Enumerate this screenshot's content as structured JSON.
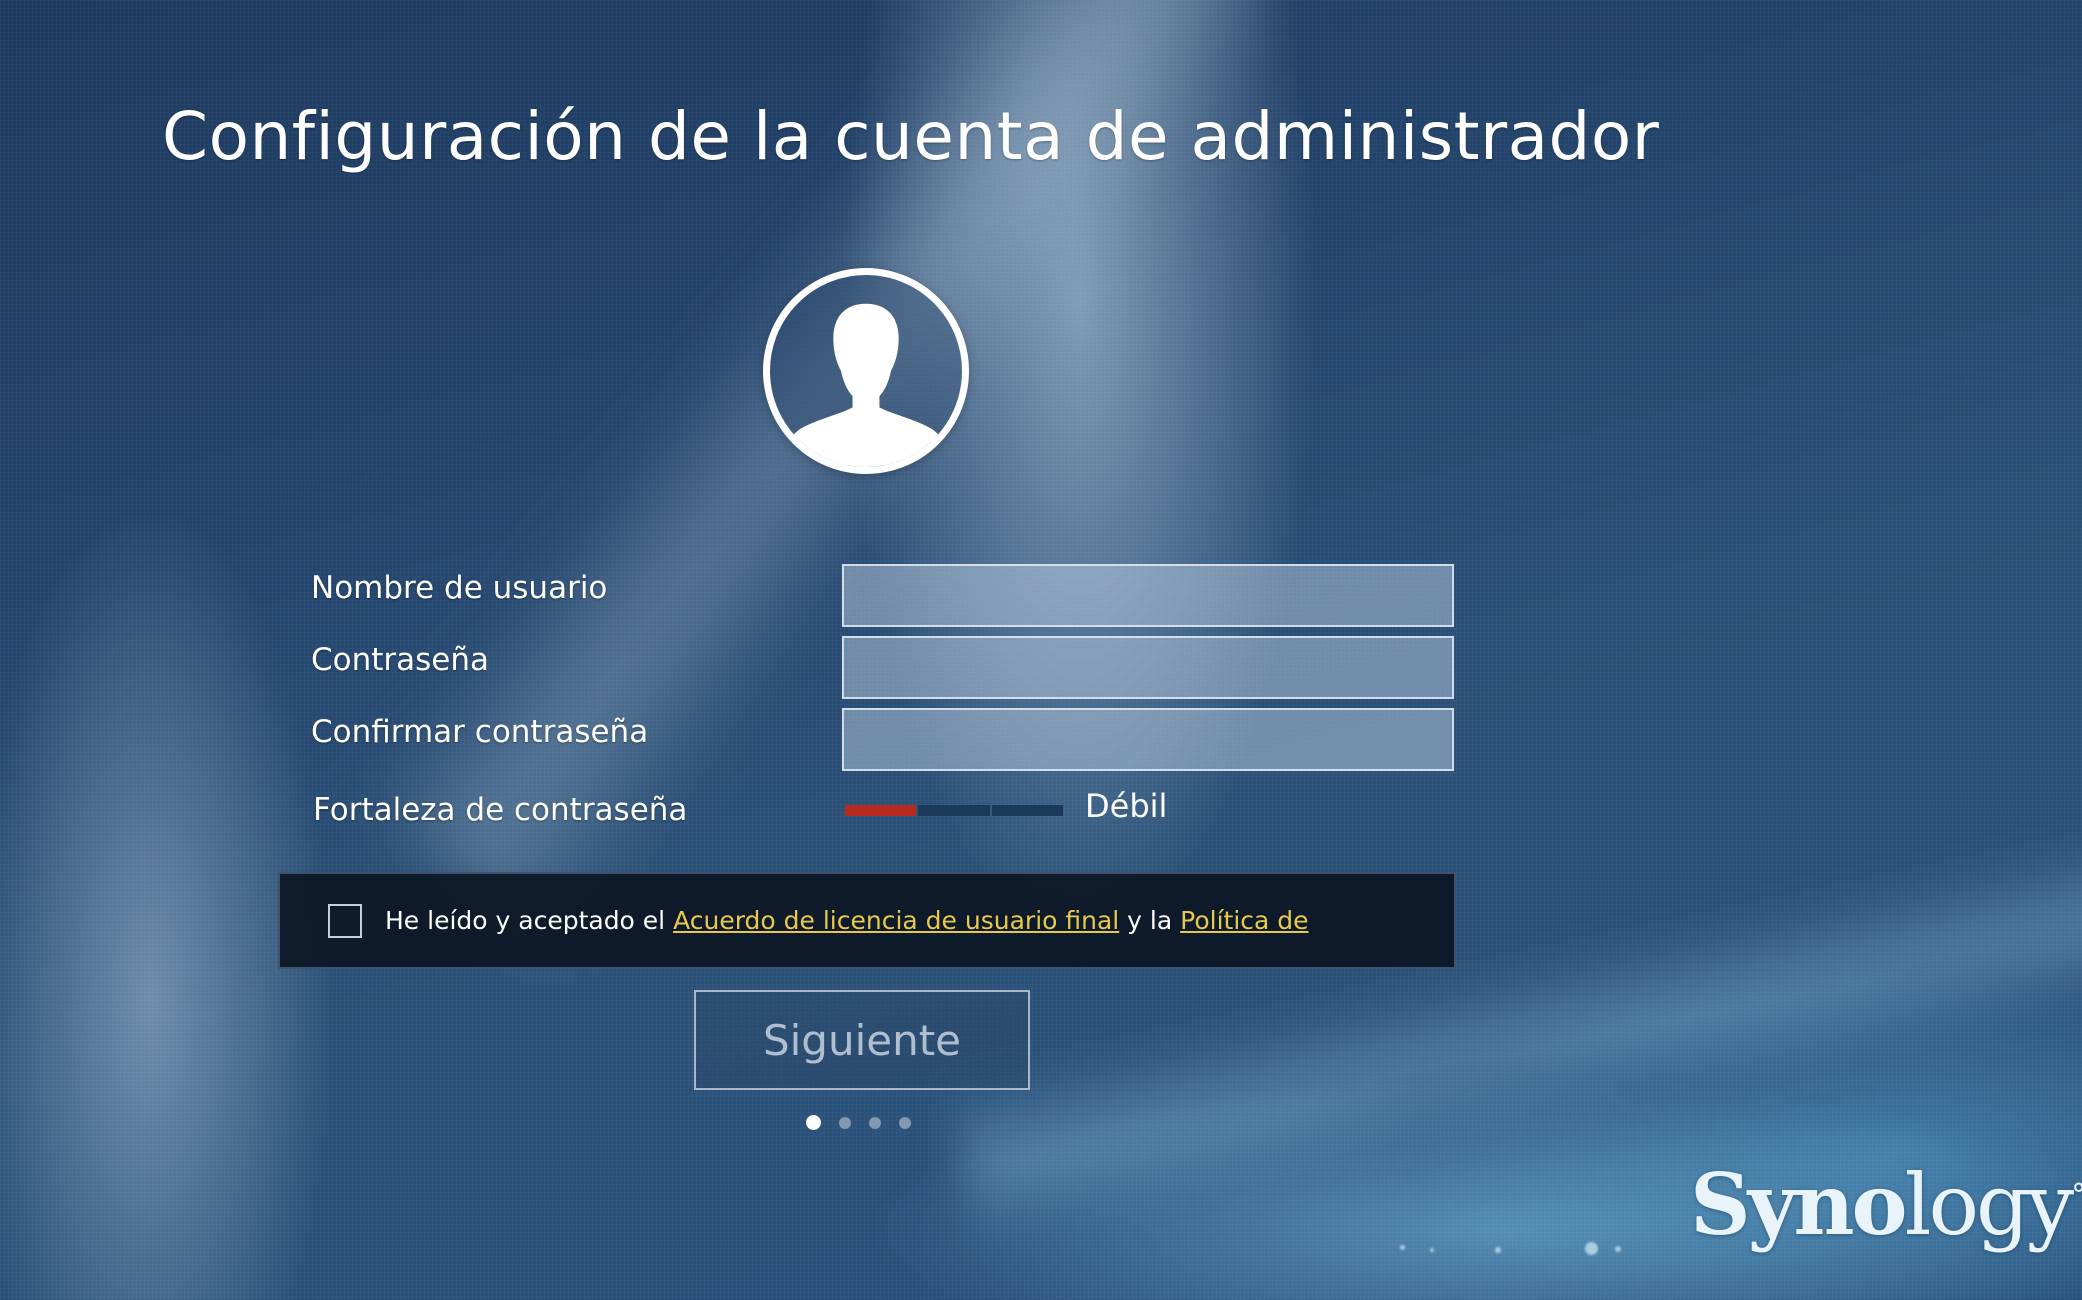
{
  "page": {
    "title": "Configuración de la cuenta de administrador"
  },
  "form": {
    "username": {
      "label": "Nombre de usuario",
      "value": ""
    },
    "password": {
      "label": "Contraseña",
      "value": ""
    },
    "confirm_password": {
      "label": "Confirmar contraseña",
      "value": ""
    },
    "strength": {
      "label": "Fortaleza de contraseña",
      "text": "Débil",
      "level": 1,
      "max_level": 3,
      "color": "#b52a1c"
    }
  },
  "agreement": {
    "checked": false,
    "prefix": "He leído y aceptado el ",
    "eula_link": "Acuerdo de licencia de usuario final",
    "middle": " y la ",
    "privacy_link": "Política de",
    "link_color": "#e6c94d"
  },
  "actions": {
    "next_label": "Siguiente"
  },
  "steps": {
    "current": 1,
    "total": 4
  },
  "brand": {
    "logo_text_bold": "Syno",
    "logo_text_light": "logy",
    "logo_mark": "°"
  },
  "icons": {
    "avatar": "user-silhouette-icon"
  }
}
